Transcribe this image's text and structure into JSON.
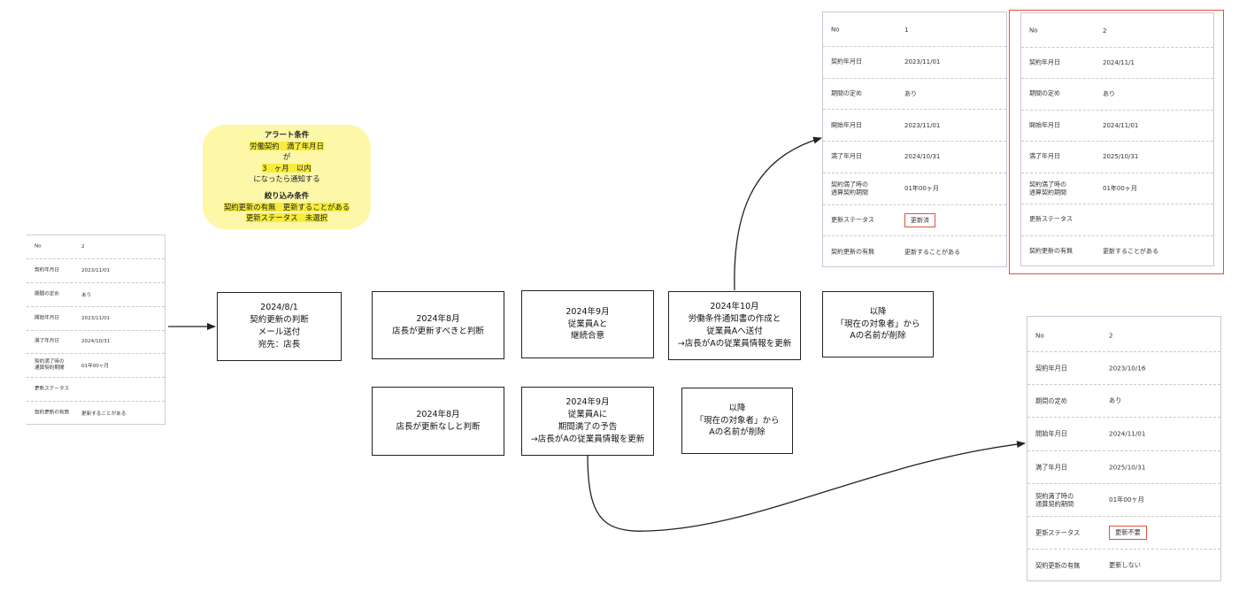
{
  "alert_note": {
    "title1": "アラート条件",
    "line1": "労働契約　満了年月日",
    "line2": "が",
    "line3": "3　ヶ月　以内",
    "line4": "になったら通知する",
    "title2": "絞り込み条件",
    "line5": "契約更新の有無　更新することがある",
    "line6": "更新ステータス　未選択"
  },
  "source_record": {
    "rows": [
      {
        "label": "No",
        "value": "2"
      },
      {
        "label": "契約年月日",
        "value": "2023/11/01"
      },
      {
        "label": "期間の定め",
        "value": "あり"
      },
      {
        "label": "開始年月日",
        "value": "2023/11/01"
      },
      {
        "label": "満了年月日",
        "value": "2024/10/31"
      },
      {
        "label": "契約満了時の\n通算契約期間",
        "value": "01年00ヶ月"
      },
      {
        "label": "更新ステータス",
        "value": ""
      },
      {
        "label": "契約更新の有無",
        "value": "更新することがある"
      }
    ]
  },
  "steps": {
    "s1": "2024/8/1\n契約更新の判断\nメール送付\n宛先：店長",
    "s2a": "2024年8月\n店長が更新すべきと判断",
    "s3a": "2024年9月\n従業員Aと\n継続合意",
    "s4a": "2024年10月\n労働条件通知書の作成と\n従業員Aへ送付\n→店長がAの従業員情報を更新",
    "s5a": "以降\n「現在の対象者」から\nAの名前が削除",
    "s2b": "2024年8月\n店長が更新なしと判断",
    "s3b": "2024年9月\n従業員Aに\n期間満了の予告\n→店長がAの従業員情報を更新",
    "s4b": "以降\n「現在の対象者」から\nAの名前が削除"
  },
  "record_renewed_1": {
    "rows": [
      {
        "label": "No",
        "value": "1"
      },
      {
        "label": "契約年月日",
        "value": "2023/11/01"
      },
      {
        "label": "期間の定め",
        "value": "あり"
      },
      {
        "label": "開始年月日",
        "value": "2023/11/01"
      },
      {
        "label": "満了年月日",
        "value": "2024/10/31"
      },
      {
        "label": "契約満了時の\n通算契約期間",
        "value": "01年00ヶ月"
      },
      {
        "label": "更新ステータス",
        "value": "更新済"
      },
      {
        "label": "契約更新の有無",
        "value": "更新することがある"
      }
    ]
  },
  "record_renewed_2": {
    "rows": [
      {
        "label": "No",
        "value": "2"
      },
      {
        "label": "契約年月日",
        "value": "2024/11/1"
      },
      {
        "label": "期間の定め",
        "value": "あり"
      },
      {
        "label": "開始年月日",
        "value": "2024/11/01"
      },
      {
        "label": "満了年月日",
        "value": "2025/10/31"
      },
      {
        "label": "契約満了時の\n通算契約期間",
        "value": "01年00ヶ月"
      },
      {
        "label": "更新ステータス",
        "value": ""
      },
      {
        "label": "契約更新の有無",
        "value": "更新することがある"
      }
    ]
  },
  "record_not_renewed": {
    "rows": [
      {
        "label": "No",
        "value": "2"
      },
      {
        "label": "契約年月日",
        "value": "2023/10/16"
      },
      {
        "label": "期間の定め",
        "value": "あり"
      },
      {
        "label": "開始年月日",
        "value": "2024/11/01"
      },
      {
        "label": "満了年月日",
        "value": "2025/10/31"
      },
      {
        "label": "契約満了時の\n通算契約期間",
        "value": "01年00ヶ月"
      },
      {
        "label": "更新ステータス",
        "value": "更新不要"
      },
      {
        "label": "契約更新の有無",
        "value": "更新しない"
      }
    ]
  },
  "colors": {
    "highlight": "#f6ec3c",
    "note_bg": "#fdf7a8",
    "emphasis_border": "#e0523a"
  }
}
